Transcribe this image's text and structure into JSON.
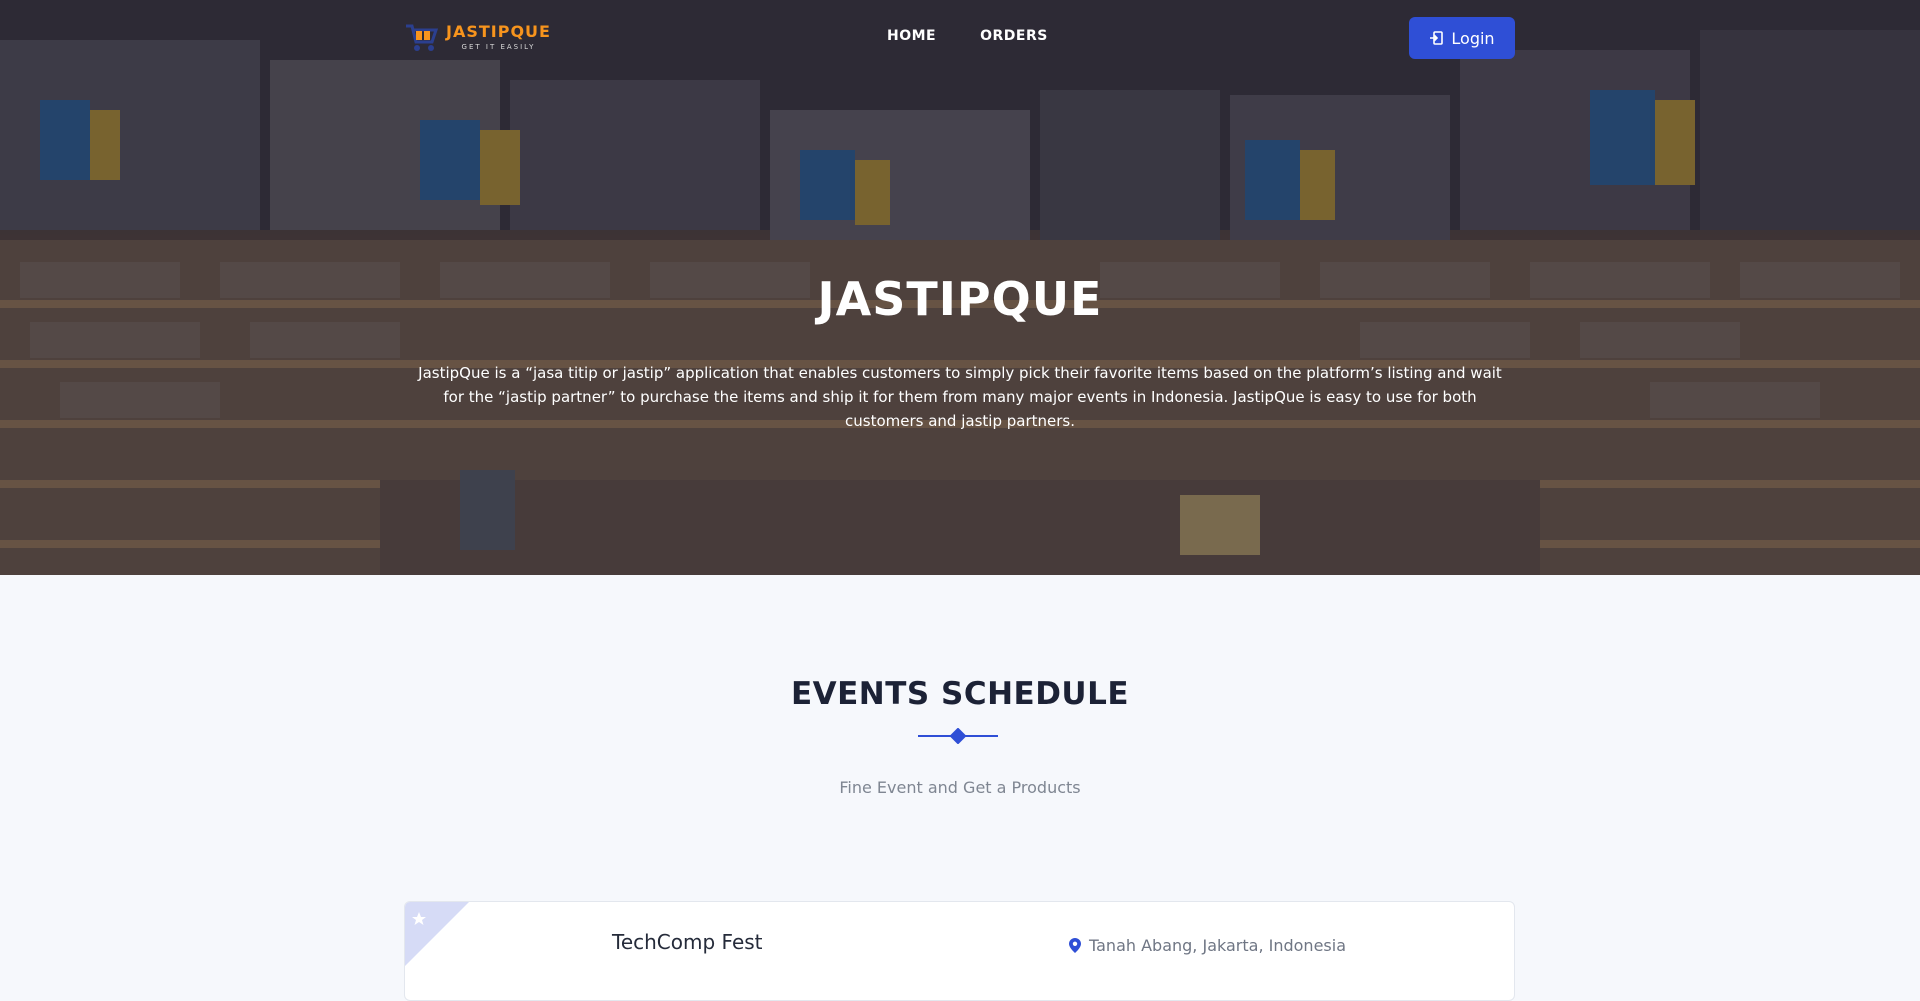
{
  "brand": {
    "name": "JASTIPQUE",
    "tagline": "GET IT EASILY",
    "accent_color": "#f7941d"
  },
  "nav": {
    "links": [
      {
        "label": "HOME"
      },
      {
        "label": "ORDERS"
      }
    ],
    "login_label": "Login",
    "login_icon": "login-icon",
    "button_color": "#2f4fd6"
  },
  "hero": {
    "title": "JASTIPQUE",
    "description": "JastipQue is a “jasa titip or jastip” application that enables customers to simply pick their favorite items based on the platform’s listing and wait for the “jastip partner” to purchase the items and ship it for them from many major events in Indonesia. JastipQue is easy to use for both customers and jastip partners."
  },
  "events": {
    "title": "EVENTS SCHEDULE",
    "subtitle": "Fine Event and Get a Products",
    "items": [
      {
        "name": "TechComp Fest",
        "location": "Tanah Abang, Jakarta, Indonesia",
        "location_icon": "map-pin-icon",
        "ribbon_icon": "star-icon"
      }
    ]
  }
}
